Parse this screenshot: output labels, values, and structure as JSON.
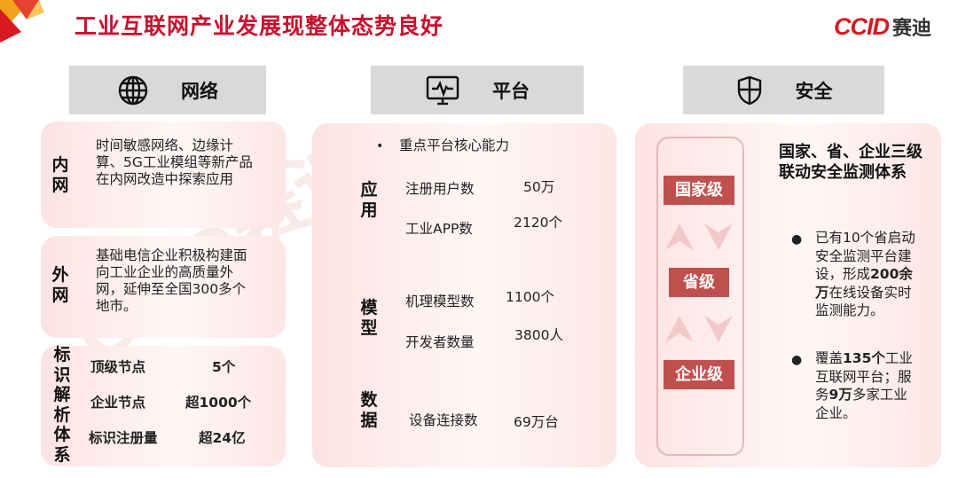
{
  "header": {
    "title": "工业互联网产业发展现整体态势良好",
    "logo_text": "CCID",
    "logo_cn": "赛迪"
  },
  "watermark": {
    "text": "CCID赛迪"
  },
  "sections": {
    "network": {
      "label": "网络",
      "icon": "globe-icon"
    },
    "platform": {
      "label": "平台",
      "icon": "monitor-pulse-icon"
    },
    "security": {
      "label": "安全",
      "icon": "shield-icon"
    }
  },
  "network": {
    "inner": {
      "tag": "内网",
      "text": "时间敏感网络、边缘计算、5G工业模组等新产品在内网改造中探索应用"
    },
    "outer": {
      "tag": "外网",
      "text": "基础电信企业积极构建面向工业企业的高质量外网，延伸至全国300多个地市。"
    },
    "identity": {
      "tag": "标识解析体系",
      "rows": [
        {
          "label": "顶级节点",
          "value": "5个"
        },
        {
          "label": "企业节点",
          "value": "超1000个"
        },
        {
          "label": "标识注册量",
          "value": "超24亿"
        }
      ]
    }
  },
  "platform": {
    "bullet": "重点平台核心能力",
    "groups": [
      {
        "tag": "应用",
        "rows": [
          {
            "label": "注册用户数",
            "value": "50万"
          },
          {
            "label": "工业APP数",
            "value": "2120个"
          }
        ]
      },
      {
        "tag": "模型",
        "rows": [
          {
            "label": "机理模型数",
            "value": "1100个"
          },
          {
            "label": "开发者数量",
            "value": "3800人"
          }
        ]
      },
      {
        "tag": "数据",
        "rows": [
          {
            "label": "设备连接数",
            "value": "69万台"
          }
        ]
      }
    ]
  },
  "security": {
    "levels": [
      "国家级",
      "省级",
      "企业级"
    ],
    "heading": "国家、省、企业三级联动安全监测体系",
    "b1_a": "已有10个省启动安全监测平台建设，形成",
    "b1_bold": "200余万",
    "b1_b": "在线设备实时监测能力。",
    "b2_a": "覆盖",
    "b2_bold1": "135个",
    "b2_b": "工业互联网平台；服务",
    "b2_bold2": "9万",
    "b2_c": "多家工业企业。"
  },
  "colors": {
    "accent_red": "#c8102e",
    "level_box": "#c0504d",
    "arrow": "#f2c9c9"
  }
}
